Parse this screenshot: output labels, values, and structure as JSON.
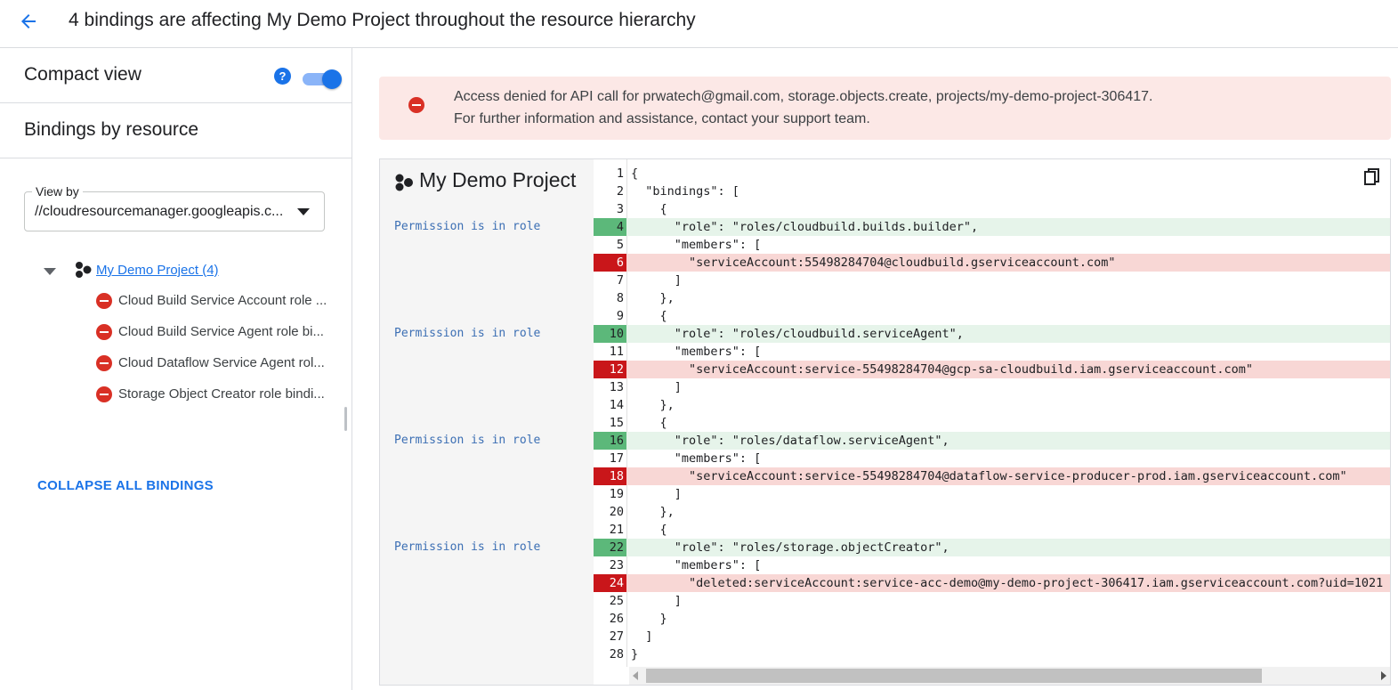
{
  "header": {
    "title": "4 bindings are affecting My Demo Project throughout the resource hierarchy"
  },
  "sidebar": {
    "compact_label": "Compact view",
    "compact_enabled": true,
    "help_glyph": "?",
    "bindings_label": "Bindings by resource",
    "view_by": {
      "label": "View by",
      "value": "//cloudresourcemanager.googleapis.c..."
    },
    "tree": {
      "project": "My Demo Project (4)",
      "items": [
        {
          "label": "Cloud Build Service Account role ..."
        },
        {
          "label": "Cloud Build Service Agent role bi..."
        },
        {
          "label": "Cloud Dataflow Service Agent rol..."
        },
        {
          "label": "Storage Object Creator role bindi..."
        }
      ]
    },
    "collapse_label": "COLLAPSE ALL BINDINGS"
  },
  "alert": {
    "line1": "Access denied for API call for prwatech@gmail.com, storage.objects.create, projects/my-demo-project-306417.",
    "line2": "For further information and assistance, contact your support team."
  },
  "code_panel": {
    "title": "My Demo Project",
    "annotations": [
      {
        "line": 4,
        "text": "Permission is in role"
      },
      {
        "line": 10,
        "text": "Permission is in role"
      },
      {
        "line": 16,
        "text": "Permission is in role"
      },
      {
        "line": 22,
        "text": "Permission is in role"
      }
    ],
    "lines": [
      {
        "n": "1",
        "text": "{",
        "hl": ""
      },
      {
        "n": "2",
        "text": "  \"bindings\": [",
        "hl": ""
      },
      {
        "n": "3",
        "text": "    {",
        "hl": ""
      },
      {
        "n": "4",
        "text": "      \"role\": \"roles/cloudbuild.builds.builder\",",
        "hl": "green"
      },
      {
        "n": "5",
        "text": "      \"members\": [",
        "hl": ""
      },
      {
        "n": "6",
        "text": "        \"serviceAccount:55498284704@cloudbuild.gserviceaccount.com\"",
        "hl": "red"
      },
      {
        "n": "7",
        "text": "      ]",
        "hl": ""
      },
      {
        "n": "8",
        "text": "    },",
        "hl": ""
      },
      {
        "n": "9",
        "text": "    {",
        "hl": ""
      },
      {
        "n": "10",
        "text": "      \"role\": \"roles/cloudbuild.serviceAgent\",",
        "hl": "green"
      },
      {
        "n": "11",
        "text": "      \"members\": [",
        "hl": ""
      },
      {
        "n": "12",
        "text": "        \"serviceAccount:service-55498284704@gcp-sa-cloudbuild.iam.gserviceaccount.com\"",
        "hl": "red"
      },
      {
        "n": "13",
        "text": "      ]",
        "hl": ""
      },
      {
        "n": "14",
        "text": "    },",
        "hl": ""
      },
      {
        "n": "15",
        "text": "    {",
        "hl": ""
      },
      {
        "n": "16",
        "text": "      \"role\": \"roles/dataflow.serviceAgent\",",
        "hl": "green"
      },
      {
        "n": "17",
        "text": "      \"members\": [",
        "hl": ""
      },
      {
        "n": "18",
        "text": "        \"serviceAccount:service-55498284704@dataflow-service-producer-prod.iam.gserviceaccount.com\"",
        "hl": "red"
      },
      {
        "n": "19",
        "text": "      ]",
        "hl": ""
      },
      {
        "n": "20",
        "text": "    },",
        "hl": ""
      },
      {
        "n": "21",
        "text": "    {",
        "hl": ""
      },
      {
        "n": "22",
        "text": "      \"role\": \"roles/storage.objectCreator\",",
        "hl": "green"
      },
      {
        "n": "23",
        "text": "      \"members\": [",
        "hl": ""
      },
      {
        "n": "24",
        "text": "        \"deleted:serviceAccount:service-acc-demo@my-demo-project-306417.iam.gserviceaccount.com?uid=1021",
        "hl": "red"
      },
      {
        "n": "25",
        "text": "      ]",
        "hl": ""
      },
      {
        "n": "26",
        "text": "    }",
        "hl": ""
      },
      {
        "n": "27",
        "text": "  ]",
        "hl": ""
      },
      {
        "n": "28",
        "text": "}",
        "hl": ""
      }
    ]
  },
  "icons": {
    "back": "arrow-left-icon",
    "help": "help-circle-icon",
    "project": "project-hexagon-icon",
    "deny": "deny-circle-icon",
    "copy": "copy-icon"
  },
  "colors": {
    "accent": "#1a73e8",
    "deny": "#d93025",
    "alert_bg": "#fce8e6",
    "line_green": "#5cb87a",
    "line_red": "#c9161a"
  }
}
